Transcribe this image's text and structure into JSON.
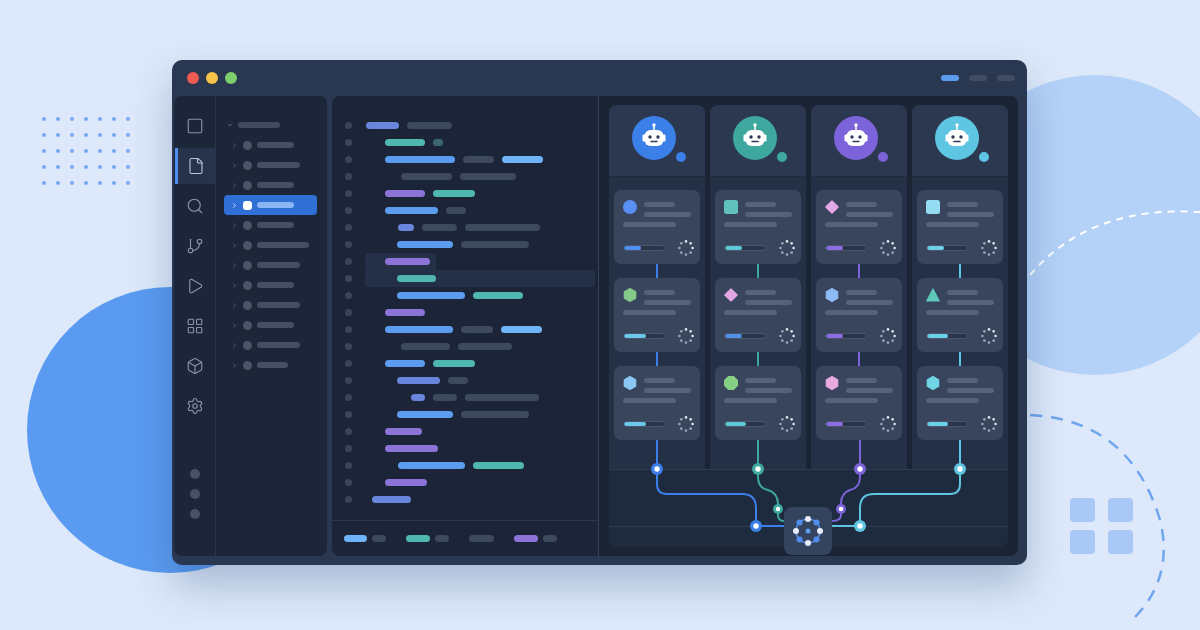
{
  "window": {
    "controls": [
      {
        "color": "#ef5b52"
      },
      {
        "color": "#f4c347"
      },
      {
        "color": "#7dcf6c"
      }
    ],
    "view_tabs": [
      {
        "selected": true
      },
      {
        "selected": false
      },
      {
        "selected": false
      }
    ]
  },
  "activity_bar": {
    "items": [
      {
        "kind": "panel",
        "selected": false
      },
      {
        "kind": "file",
        "selected": true
      },
      {
        "kind": "search",
        "selected": false
      },
      {
        "kind": "branch",
        "selected": false
      },
      {
        "kind": "run",
        "selected": false
      },
      {
        "kind": "extensions",
        "selected": false
      },
      {
        "kind": "package",
        "selected": false
      },
      {
        "kind": "settings",
        "selected": false
      }
    ]
  },
  "explorer": {
    "root": {
      "expanded": true,
      "selected": false,
      "children": [
        {
          "expanded": false,
          "selected": false
        },
        {
          "expanded": false,
          "selected": false
        },
        {
          "expanded": false,
          "selected": false
        },
        {
          "expanded": false,
          "selected": true
        },
        {
          "expanded": false,
          "selected": false
        },
        {
          "expanded": false,
          "selected": false
        },
        {
          "expanded": false,
          "selected": false
        },
        {
          "expanded": false,
          "selected": false
        },
        {
          "expanded": false,
          "selected": false
        },
        {
          "expanded": false,
          "selected": false
        },
        {
          "expanded": false,
          "selected": false
        },
        {
          "expanded": false,
          "selected": false
        }
      ]
    }
  },
  "editor": {
    "lines": [
      {
        "selected": false,
        "current": false,
        "tokens": [
          {
            "color": "#6a86dc"
          },
          {
            "color": "#3d495c"
          }
        ]
      },
      {
        "selected": false,
        "current": false,
        "tokens": [
          {
            "color": "#4fb6b0"
          },
          {
            "color": "#3c6670"
          }
        ]
      },
      {
        "selected": false,
        "current": false,
        "tokens": [
          {
            "color": "#5c9cf0"
          },
          {
            "color": "#3d495c"
          },
          {
            "color": "#6fb3f8"
          }
        ]
      },
      {
        "selected": false,
        "current": false,
        "tokens": [
          {
            "color": "#3d495c"
          },
          {
            "color": "#3d495c"
          }
        ]
      },
      {
        "selected": false,
        "current": false,
        "tokens": [
          {
            "color": "#8b73d8"
          },
          {
            "color": "#4fb6b0"
          }
        ]
      },
      {
        "selected": false,
        "current": false,
        "tokens": [
          {
            "color": "#5c9cf0"
          },
          {
            "color": "#3d495c"
          }
        ]
      },
      {
        "selected": false,
        "current": false,
        "tokens": [
          {
            "color": "#6a86dc"
          },
          {
            "color": "#3d495c"
          },
          {
            "color": "#3d495c"
          }
        ]
      },
      {
        "selected": false,
        "current": false,
        "tokens": [
          {
            "color": "#5c9cf0"
          },
          {
            "color": "#3d495c"
          }
        ]
      },
      {
        "selected": true,
        "current": false,
        "tokens": [
          {
            "color": "#8b73d8"
          }
        ]
      },
      {
        "selected": false,
        "current": true,
        "tokens": [
          {
            "color": "#4fb6b0"
          }
        ]
      },
      {
        "selected": false,
        "current": false,
        "tokens": [
          {
            "color": "#5c9cf0"
          },
          {
            "color": "#4fb6b0"
          }
        ]
      },
      {
        "selected": false,
        "current": false,
        "tokens": [
          {
            "color": "#8b73d8"
          }
        ]
      },
      {
        "selected": false,
        "current": false,
        "tokens": [
          {
            "color": "#5c9cf0"
          },
          {
            "color": "#3d495c"
          },
          {
            "color": "#6fb3f8"
          }
        ]
      },
      {
        "selected": false,
        "current": false,
        "tokens": [
          {
            "color": "#3d495c"
          },
          {
            "color": "#3d495c"
          }
        ]
      },
      {
        "selected": false,
        "current": false,
        "tokens": [
          {
            "color": "#5c9cf0"
          },
          {
            "color": "#4fb6b0"
          }
        ]
      },
      {
        "selected": false,
        "current": false,
        "tokens": [
          {
            "color": "#6a86dc"
          },
          {
            "color": "#3d495c"
          }
        ]
      },
      {
        "selected": false,
        "current": false,
        "tokens": [
          {
            "color": "#6a86dc"
          },
          {
            "color": "#3d495c"
          },
          {
            "color": "#3d495c"
          }
        ]
      },
      {
        "selected": false,
        "current": false,
        "tokens": [
          {
            "color": "#5c9cf0"
          },
          {
            "color": "#3d495c"
          }
        ]
      },
      {
        "selected": false,
        "current": false,
        "tokens": [
          {
            "color": "#8b73d8"
          }
        ]
      },
      {
        "selected": false,
        "current": false,
        "tokens": [
          {
            "color": "#8b73d8"
          }
        ]
      },
      {
        "selected": false,
        "current": false,
        "tokens": [
          {
            "color": "#5c9cf0"
          },
          {
            "color": "#4fb6b0"
          }
        ]
      },
      {
        "selected": false,
        "current": false,
        "tokens": [
          {
            "color": "#8b73d8"
          }
        ]
      },
      {
        "selected": false,
        "current": false,
        "tokens": [
          {
            "color": "#6a86dc"
          }
        ]
      }
    ],
    "status_bar": {
      "groups": [
        {
          "tokens": [
            {
              "color": "#6fb3f8"
            },
            {
              "color": "#3d495c"
            }
          ]
        },
        {
          "tokens": [
            {
              "color": "#4fb6b0"
            },
            {
              "color": "#3d495c"
            }
          ]
        },
        {
          "tokens": [
            {
              "color": "#3d495c"
            }
          ]
        },
        {
          "tokens": [
            {
              "color": "#8b73d8"
            },
            {
              "color": "#3d495c"
            }
          ]
        }
      ]
    }
  },
  "agents": [
    {
      "color": "#3b7fe9",
      "tasks": [
        {
          "kind": "circle",
          "color": "#5a8ff3",
          "progress": {
            "level": 0.42,
            "color": "#4f8ff0"
          }
        },
        {
          "kind": "hexagon",
          "color": "#84c98a",
          "progress": {
            "level": 0.55,
            "color": "#6cc8ea"
          }
        },
        {
          "kind": "hexagon",
          "color": "#8cc8f4",
          "progress": {
            "level": 0.55,
            "color": "#6cc8ea"
          }
        }
      ]
    },
    {
      "color": "#3ea89f",
      "tasks": [
        {
          "kind": "square",
          "color": "#5fc2bb",
          "progress": {
            "level": 0.42,
            "color": "#5ccad6"
          }
        },
        {
          "kind": "diamond",
          "color": "#e3a6e3",
          "progress": {
            "level": 0.42,
            "color": "#5290ea"
          }
        },
        {
          "kind": "octagon",
          "color": "#86d086",
          "progress": {
            "level": 0.52,
            "color": "#5ccad6"
          }
        }
      ]
    },
    {
      "color": "#7d63d9",
      "tasks": [
        {
          "kind": "diamond",
          "color": "#e3a9e6",
          "progress": {
            "level": 0.42,
            "color": "#8a6de2"
          }
        },
        {
          "kind": "hexagon",
          "color": "#8fbaf5",
          "progress": {
            "level": 0.42,
            "color": "#8a6de2"
          }
        },
        {
          "kind": "hexagon",
          "color": "#eba9e2",
          "progress": {
            "level": 0.42,
            "color": "#8a6de2"
          }
        }
      ]
    },
    {
      "color": "#5ec5e2",
      "tasks": [
        {
          "kind": "square",
          "color": "#93dcf2",
          "progress": {
            "level": 0.42,
            "color": "#6cd0ea"
          }
        },
        {
          "kind": "triangle",
          "color": "#5fc9b9",
          "progress": {
            "level": 0.52,
            "color": "#6cd0ea"
          }
        },
        {
          "kind": "hexagon",
          "color": "#70d6e6",
          "progress": {
            "level": 0.52,
            "color": "#6cd0ea"
          }
        }
      ]
    }
  ]
}
